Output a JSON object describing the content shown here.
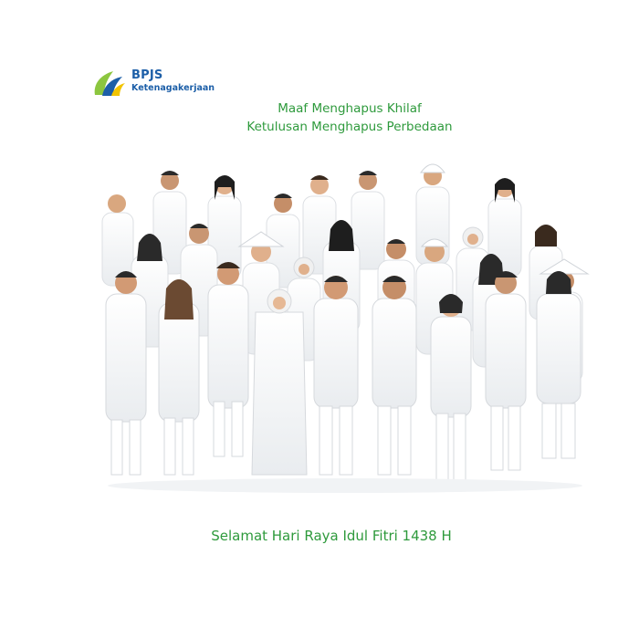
{
  "logo": {
    "brand": "BPJS",
    "sub": "Ketenagakerjaan",
    "colors": {
      "green": "#8cc63f",
      "blue": "#1d5fa8",
      "yellow": "#f2c400"
    }
  },
  "headline": {
    "line1": "Maaf Menghapus Khilaf",
    "line2": "Ketulusan Menghapus Perbedaan",
    "color": "#2e9a3c"
  },
  "photo": {
    "subject": "group-of-people-in-white-clothes-greeting-gesture"
  },
  "greeting": {
    "text": "Selamat Hari Raya Idul Fitri 1438 H",
    "color": "#2e9a3c"
  }
}
